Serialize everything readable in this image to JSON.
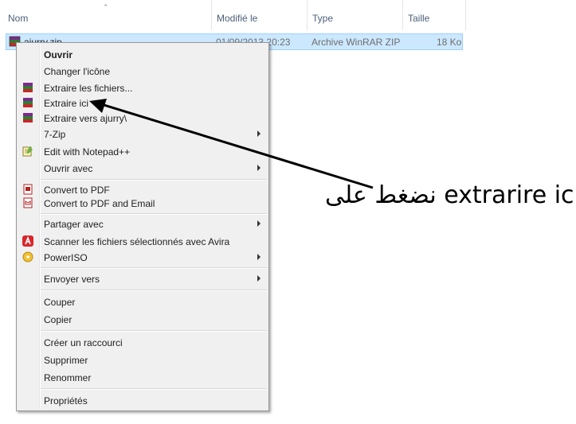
{
  "columns": [
    "Nom",
    "Modifié le",
    "Type",
    "Taille"
  ],
  "file": {
    "name": "ajurry.zip",
    "modified": "01/09/2013 20:23",
    "type": "Archive WinRAR ZIP",
    "size": "18 Ko",
    "icon": "winrar-archive-icon"
  },
  "menu": {
    "items": [
      {
        "label": "Ouvrir",
        "bold": true
      },
      {
        "label": "Changer l'icône"
      },
      {
        "label": "Extraire les fichiers...",
        "icon": "winrar-icon"
      },
      {
        "label": "Extraire ici",
        "icon": "winrar-icon"
      },
      {
        "label": "Extraire vers ajurry\\",
        "icon": "winrar-icon"
      },
      {
        "label": "7-Zip",
        "submenu": true
      },
      {
        "label": "Edit with Notepad++",
        "icon": "notepadpp-icon"
      },
      {
        "label": "Ouvrir avec",
        "submenu": true
      },
      {
        "label": "Convert to PDF",
        "icon": "pdf-icon"
      },
      {
        "label": "Convert to PDF and Email",
        "icon": "pdf-email-icon"
      },
      {
        "label": "Partager avec",
        "submenu": true
      },
      {
        "label": "Scanner les fichiers sélectionnés avec Avira",
        "icon": "avira-icon"
      },
      {
        "label": "PowerISO",
        "icon": "poweriso-icon",
        "submenu": true
      },
      {
        "label": "Envoyer vers",
        "submenu": true
      },
      {
        "label": "Couper"
      },
      {
        "label": "Copier"
      },
      {
        "label": "Créer un raccourci"
      },
      {
        "label": "Supprimer"
      },
      {
        "label": "Renommer"
      },
      {
        "label": "Propriétés"
      }
    ]
  },
  "annotation": {
    "text": "نضغط على extrarire ici",
    "color": "#000000"
  }
}
